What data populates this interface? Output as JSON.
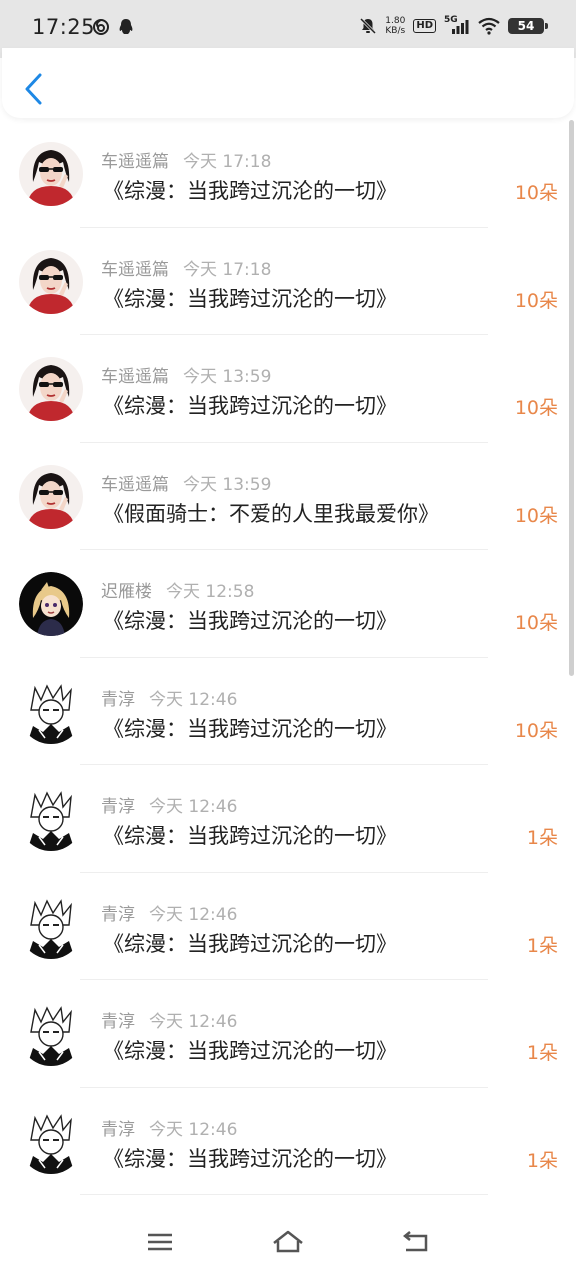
{
  "status_bar": {
    "time": "17:25",
    "net_speed_value": "1.80",
    "net_speed_unit": "KB/s",
    "hd_label": "HD",
    "signal_label": "5G",
    "battery": "54"
  },
  "header": {
    "back_icon": "chevron-left-icon",
    "accent_color": "#1e88e5"
  },
  "records": [
    {
      "user": "车遥遥篇",
      "time": "今天 17:18",
      "title": "《综漫：当我跨过沉沦的一切》",
      "amount": "10朵",
      "avatar": "avatar-girl-sunglasses"
    },
    {
      "user": "车遥遥篇",
      "time": "今天 17:18",
      "title": "《综漫：当我跨过沉沦的一切》",
      "amount": "10朵",
      "avatar": "avatar-girl-sunglasses"
    },
    {
      "user": "车遥遥篇",
      "time": "今天 13:59",
      "title": "《综漫：当我跨过沉沦的一切》",
      "amount": "10朵",
      "avatar": "avatar-girl-sunglasses"
    },
    {
      "user": "车遥遥篇",
      "time": "今天 13:59",
      "title": "《假面骑士：不爱的人里我最爱你》",
      "amount": "10朵",
      "avatar": "avatar-girl-sunglasses"
    },
    {
      "user": "迟雁楼",
      "time": "今天 12:58",
      "title": "《综漫：当我跨过沉沦的一切》",
      "amount": "10朵",
      "avatar": "avatar-blonde-anime"
    },
    {
      "user": "青淳",
      "time": "今天 12:46",
      "title": "《综漫：当我跨过沉沦的一切》",
      "amount": "10朵",
      "avatar": "avatar-sketch-anime"
    },
    {
      "user": "青淳",
      "time": "今天 12:46",
      "title": "《综漫：当我跨过沉沦的一切》",
      "amount": "1朵",
      "avatar": "avatar-sketch-anime"
    },
    {
      "user": "青淳",
      "time": "今天 12:46",
      "title": "《综漫：当我跨过沉沦的一切》",
      "amount": "1朵",
      "avatar": "avatar-sketch-anime"
    },
    {
      "user": "青淳",
      "time": "今天 12:46",
      "title": "《综漫：当我跨过沉沦的一切》",
      "amount": "1朵",
      "avatar": "avatar-sketch-anime"
    },
    {
      "user": "青淳",
      "time": "今天 12:46",
      "title": "《综漫：当我跨过沉沦的一切》",
      "amount": "1朵",
      "avatar": "avatar-sketch-anime"
    }
  ],
  "colors": {
    "amount": "#e8874a",
    "username": "#9a9a9a",
    "title": "#222222"
  },
  "nav_bar": {
    "menu_icon": "menu-icon",
    "home_icon": "home-icon",
    "back_icon": "back-icon"
  }
}
